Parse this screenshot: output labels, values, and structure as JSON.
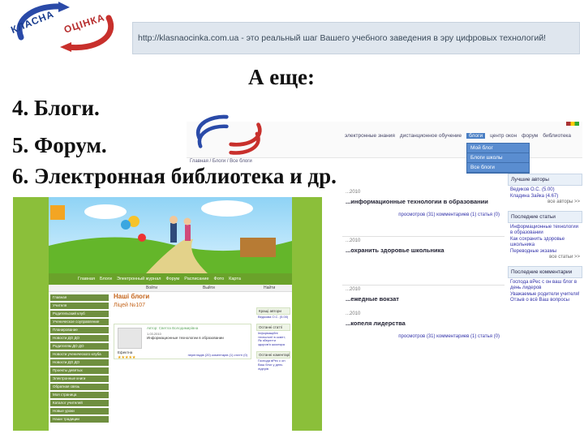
{
  "logo": {
    "line1": "КЛАСНА",
    "line2": "ОЦІНКА"
  },
  "banner": {
    "url_text": "http://klasnaocinka.com.ua - это реальный шаг Вашего учебного заведения в эру цифровых технологий!"
  },
  "heading": "А еще:",
  "list": [
    "4. Блоги.",
    "5. Форум.",
    "6. Электронная библиотека и др."
  ],
  "blog_page": {
    "nav": [
      "электронные знания",
      "дистанционное обучение",
      "блоги",
      "центр окон",
      "форум",
      "библиотека"
    ],
    "active_nav": "блоги",
    "dropdown": [
      "Мой блог",
      "Блоги школы",
      "Все блоги"
    ],
    "breadcrumb": "Главная / Блоги / Все блоги",
    "posts": [
      {
        "date": "...2010",
        "title": "...информационные технологии в образовании",
        "meta": "просмотров (31)   комментариев (1)   статья (0)"
      },
      {
        "date": "...2010",
        "title": "...охранить здоровье школьника",
        "meta": ""
      },
      {
        "date": "...2010",
        "title": "...ежедные вокзат",
        "meta": ""
      },
      {
        "date": "...2010",
        "title": "...копеля лидерства",
        "meta": "просмотров (31)   комментариев (1)   статья (0)"
      }
    ],
    "sidebar": {
      "authors_title": "Лучшие авторы",
      "authors": [
        "Ведиков О.С. (5.00)",
        "Кладина Зайка (4.67)"
      ],
      "authors_more": "все авторы >>",
      "articles_title": "Последние статьи",
      "articles": [
        "Информационные технологии в образовании",
        "Как сохранить здоровье школьника",
        "Переводные экзамы"
      ],
      "articles_more": "все статьи >>",
      "comments_title": "Последние комментарии",
      "comments": [
        "Господа вРес с он ваш блог в день лидеров",
        "Уважаемые родители учителя! Отзыв о всё Ваш вопросы"
      ]
    }
  },
  "green_site": {
    "menu": [
      "Главная",
      "Блоги",
      "Электронный журнал",
      "Форум",
      "Расписание",
      "Фото",
      "Карта"
    ],
    "bar_left": "Войти",
    "bar_mid": "Выйти",
    "bar_right": "Найти",
    "sidebar": [
      "Главная",
      "Учителя",
      "Родительский клуб",
      "Ученическое соуправление",
      "Планирование",
      "Новости ДО ДО",
      "Родителям ДО ДО",
      "Новости ученического клуба",
      "Новости ДО ДО",
      "Проекты девятых",
      "Электронные книги",
      "Обратная связь",
      "Моя страница",
      "Каталог учителей",
      "Новые уроки",
      "Наши традиции"
    ],
    "title": "Наші блоги",
    "subtitle": "Ліцей №107",
    "card_header": "Автор: Светла Володимирівна",
    "card_date": "1.03.2010",
    "card_text": "Информационные технологии в образовании",
    "author_name": "Ефектна",
    "stars": "★★★★★",
    "card_links": "переглядів (20)   коментарів (1)   статті (0)",
    "right_boxes": [
      {
        "title": "Кращі автори",
        "body": "Ведікова О.С. (5.00)"
      },
      {
        "title": "Останні статті",
        "body": "Інформаційні технології в освіті; Як зберегти здоров'я школяра"
      },
      {
        "title": "Останні коментарі",
        "body": "Господа вРес с он Ваш блог у день лідерів"
      }
    ]
  },
  "colors": {
    "green_bg": "#8bbf3a",
    "menu_green": "#6aa22a",
    "accent_blue": "#4a7fc4",
    "title_orange": "#c4641a"
  }
}
